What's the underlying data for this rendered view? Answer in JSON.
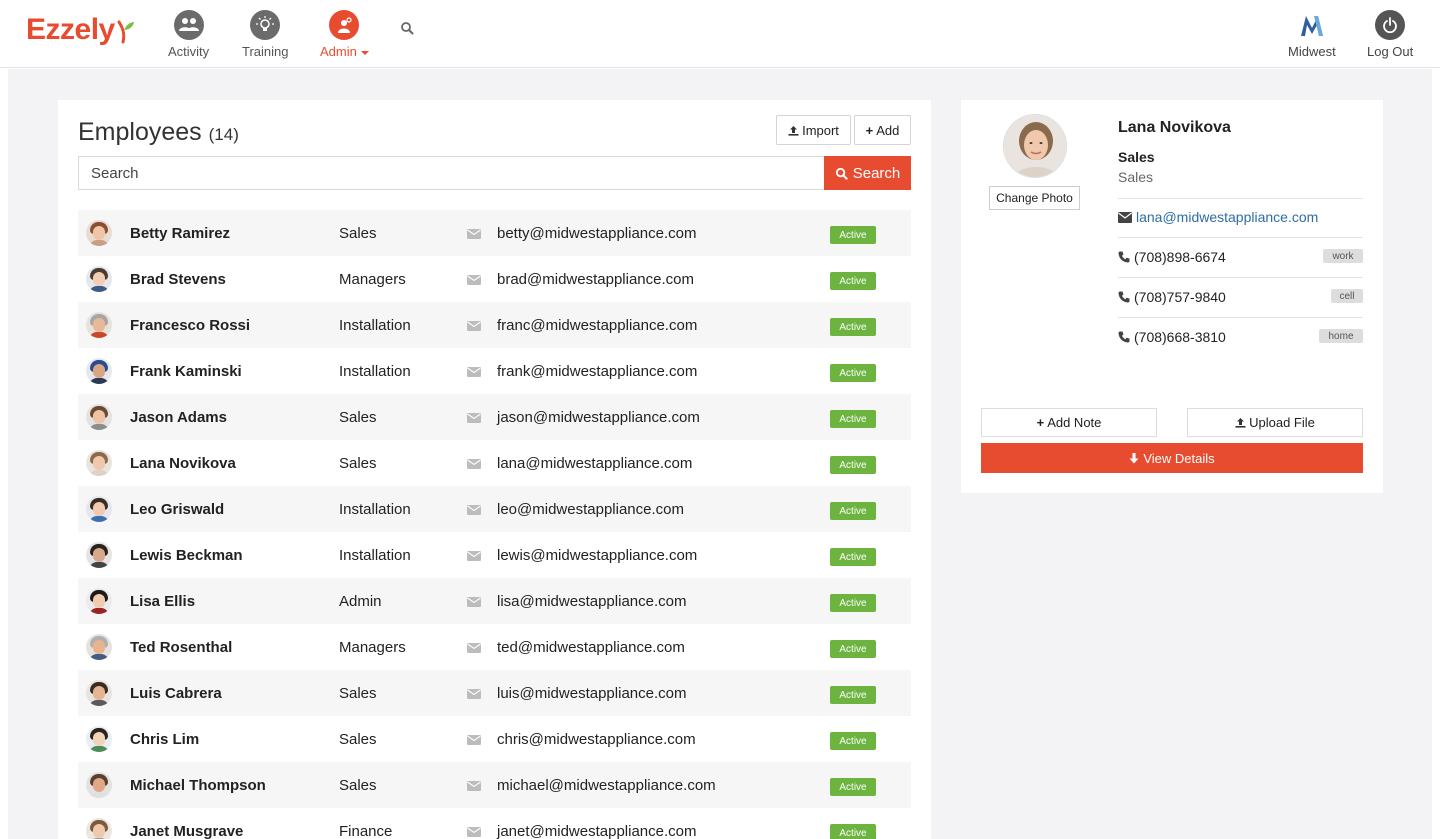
{
  "brand": {
    "name": "Ezzely",
    "color": "#e84c30"
  },
  "nav": {
    "items": [
      {
        "label": "Activity",
        "icon": "people-icon"
      },
      {
        "label": "Training",
        "icon": "lightbulb-icon"
      },
      {
        "label": "Admin",
        "icon": "admin-gear-icon",
        "active": true
      }
    ],
    "right": [
      {
        "label": "Midwest",
        "icon": "midwest-logo-icon"
      },
      {
        "label": "Log Out",
        "icon": "power-icon"
      }
    ]
  },
  "employees": {
    "title": "Employees",
    "count": "(14)",
    "import_label": "Import",
    "add_label": "Add",
    "search_placeholder": "Search",
    "search_button": "Search",
    "rows": [
      {
        "name": "Betty Ramirez",
        "dept": "Sales",
        "email": "betty@midwestappliance.com",
        "status": "Active"
      },
      {
        "name": "Brad Stevens",
        "dept": "Managers",
        "email": "brad@midwestappliance.com",
        "status": "Active"
      },
      {
        "name": "Francesco Rossi",
        "dept": "Installation",
        "email": "franc@midwestappliance.com",
        "status": "Active"
      },
      {
        "name": "Frank Kaminski",
        "dept": "Installation",
        "email": "frank@midwestappliance.com",
        "status": "Active"
      },
      {
        "name": "Jason Adams",
        "dept": "Sales",
        "email": "jason@midwestappliance.com",
        "status": "Active"
      },
      {
        "name": "Lana Novikova",
        "dept": "Sales",
        "email": "lana@midwestappliance.com",
        "status": "Active"
      },
      {
        "name": "Leo Griswald",
        "dept": "Installation",
        "email": "leo@midwestappliance.com",
        "status": "Active"
      },
      {
        "name": "Lewis Beckman",
        "dept": "Installation",
        "email": "lewis@midwestappliance.com",
        "status": "Active"
      },
      {
        "name": "Lisa Ellis",
        "dept": "Admin",
        "email": "lisa@midwestappliance.com",
        "status": "Active"
      },
      {
        "name": "Ted Rosenthal",
        "dept": "Managers",
        "email": "ted@midwestappliance.com",
        "status": "Active"
      },
      {
        "name": "Luis Cabrera",
        "dept": "Sales",
        "email": "luis@midwestappliance.com",
        "status": "Active"
      },
      {
        "name": "Chris Lim",
        "dept": "Sales",
        "email": "chris@midwestappliance.com",
        "status": "Active"
      },
      {
        "name": "Michael Thompson",
        "dept": "Sales",
        "email": "michael@midwestappliance.com",
        "status": "Active"
      },
      {
        "name": "Janet Musgrave",
        "dept": "Finance",
        "email": "janet@midwestappliance.com",
        "status": "Active"
      }
    ]
  },
  "detail": {
    "name": "Lana Novikova",
    "dept": "Sales",
    "subdept": "Sales",
    "change_photo": "Change Photo",
    "email": "lana@midwestappliance.com",
    "phones": [
      {
        "number": "(708)898-6674",
        "tag": "work"
      },
      {
        "number": "(708)757-9840",
        "tag": "cell"
      },
      {
        "number": "(708)668-3810",
        "tag": "home"
      }
    ],
    "add_note": "Add Note",
    "upload_file": "Upload File",
    "view_details": "View Details"
  },
  "colors": {
    "accent": "#e84c30",
    "active_badge": "#6cb43f",
    "link": "#2e6da4"
  }
}
